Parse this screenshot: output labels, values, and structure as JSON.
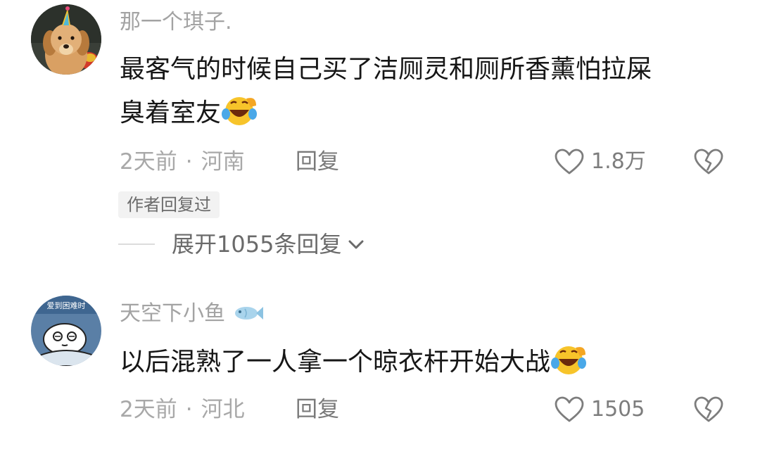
{
  "comments": [
    {
      "username": "那一个琪子.",
      "avatar": "golden-retriever-puppy-party-hat",
      "text_line1": "最客气的时候自己买了洁厕灵和厕所香薰怕拉屎",
      "text_line2": "臭着室友",
      "emoji": "laughing-crying-emoji",
      "time": "2天前",
      "separator": "·",
      "location": "河南",
      "reply_label": "回复",
      "like_count": "1.8万",
      "author_replied": "作者回复过",
      "expand_label": "展开1055条回复"
    },
    {
      "username": "天空下小鱼",
      "avatar": "cartoon-face-under-blanket",
      "avatar_caption": "爱到困难时",
      "username_icon": "fish-icon",
      "text_line1": "以后混熟了一人拿一个晾衣杆开始大战",
      "emoji": "laughing-crying-emoji",
      "time": "2天前",
      "separator": "·",
      "location": "河北",
      "reply_label": "回复",
      "like_count": "1505"
    }
  ],
  "colors": {
    "text": "#161616",
    "secondary": "#a8a8a8",
    "icon": "#8a8a8a",
    "badge_bg": "#f2f2f2"
  }
}
